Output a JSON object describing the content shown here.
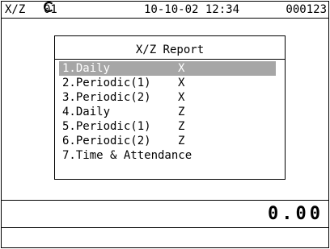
{
  "status_bar": {
    "mode": "X/Z",
    "clerk": "01",
    "clerk_icon": "clerk-c-icon",
    "datetime": "10-10-02 12:34",
    "counter": "000123"
  },
  "report": {
    "title": "X/Z Report",
    "items": [
      {
        "label": "1.Daily",
        "type": "X",
        "selected": true
      },
      {
        "label": "2.Periodic(1)",
        "type": "X",
        "selected": false
      },
      {
        "label": "3.Periodic(2)",
        "type": "X",
        "selected": false
      },
      {
        "label": "4.Daily",
        "type": "Z",
        "selected": false
      },
      {
        "label": "5.Periodic(1)",
        "type": "Z",
        "selected": false
      },
      {
        "label": "6.Periodic(2)",
        "type": "Z",
        "selected": false
      },
      {
        "label": "7.Time & Attendance",
        "type": "",
        "selected": false
      }
    ],
    "selected_color": "#a6a6a6"
  },
  "amount": {
    "value": "0.00"
  }
}
